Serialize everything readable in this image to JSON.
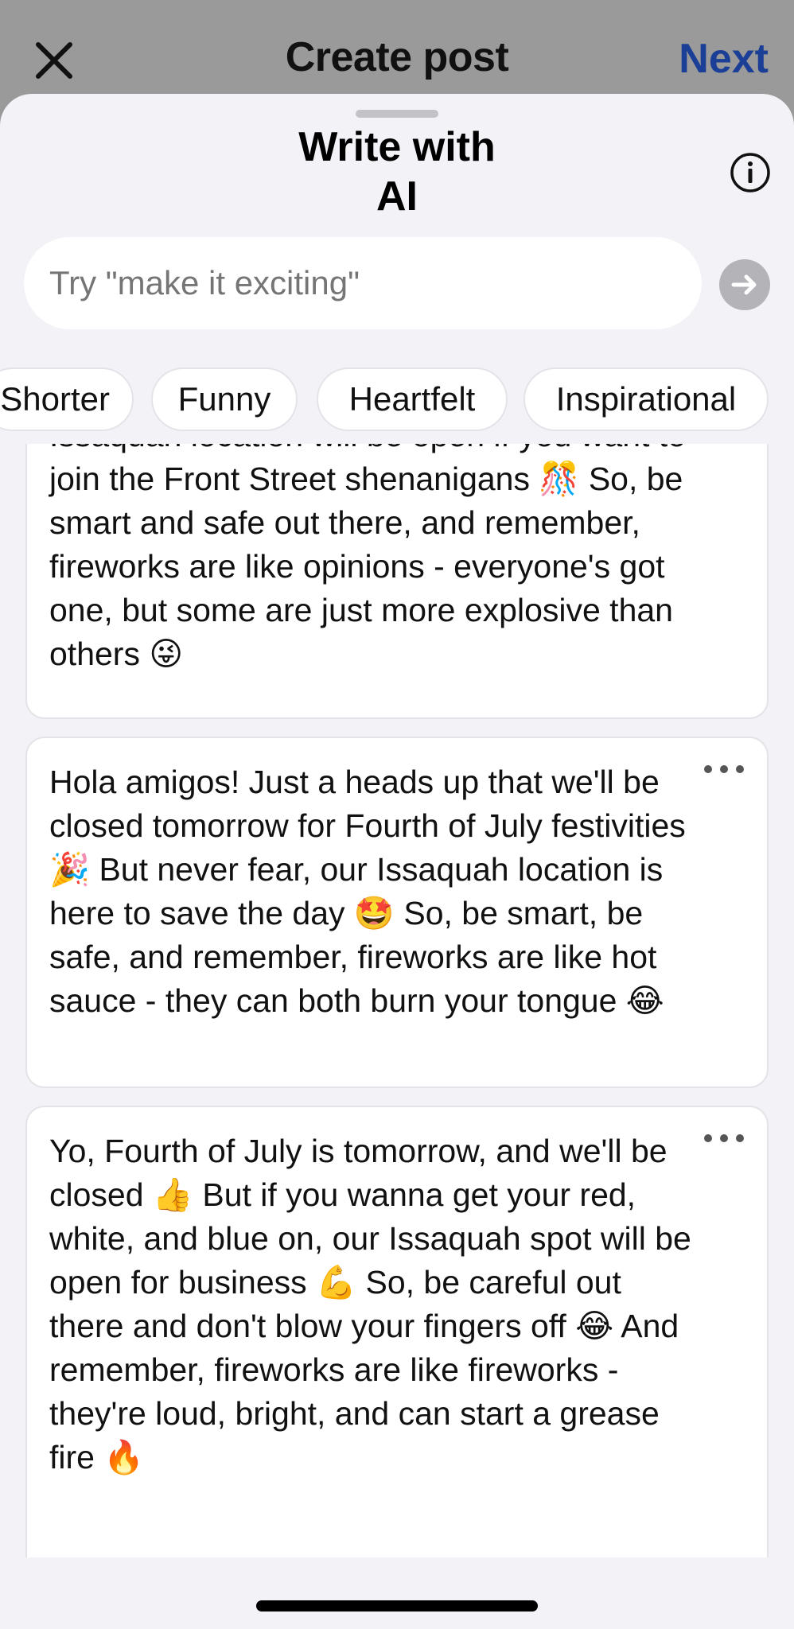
{
  "header": {
    "close_icon": "close-icon",
    "title": "Create post",
    "next_label": "Next"
  },
  "sheet": {
    "title_line1": "Write with",
    "title_line2": "AI",
    "info_icon": "info-icon"
  },
  "prompt": {
    "placeholder": "Try \"make it exciting\"",
    "send_icon": "arrow-right-icon"
  },
  "chips": [
    "Shorter",
    "Funny",
    "Heartfelt",
    "Inspirational"
  ],
  "cards": [
    {
      "text": "Issaquah location will be open if you want to join the Front Street shenanigans 🎊 So, be smart and safe out there, and remember, fireworks are like opinions - everyone's got one, but some are just more explosive than others 😜"
    },
    {
      "text": "Hola amigos! Just a heads up that we'll be closed tomorrow for Fourth of July festivities 🎉 But never fear, our Issaquah location is here to save the day 🤩 So, be smart, be safe, and remember, fireworks are like hot sauce - they can both burn your tongue 😂"
    },
    {
      "text": "Yo, Fourth of July is tomorrow, and we'll be closed 👍 But if you wanna get your red, white, and blue on, our Issaquah spot will be open for business 💪 So, be careful out there and don't blow your fingers off 😂 And remember, fireworks are like fireworks - they're loud, bright, and can start a grease fire 🔥"
    }
  ],
  "more_icon": "more-horizontal-icon",
  "colors": {
    "accent": "#1b3f96",
    "sheet_bg": "#f2f2f7",
    "overlay": "#9a9a9a"
  }
}
